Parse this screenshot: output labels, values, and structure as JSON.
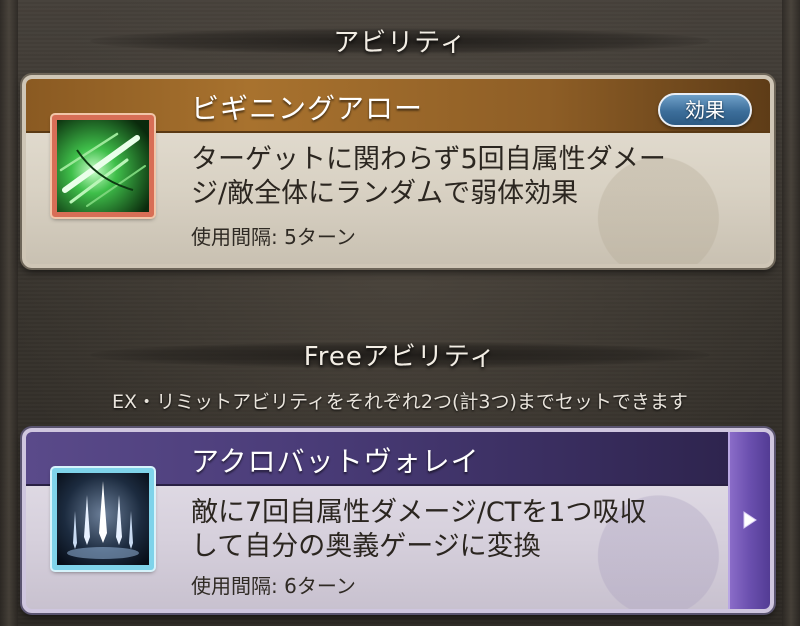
{
  "sections": {
    "ability": {
      "header": "アビリティ"
    },
    "free": {
      "header": "Freeアビリティ",
      "note": "EX・リミットアビリティをそれぞれ2つ(計3つ)までセットできます"
    }
  },
  "ability_card": {
    "name": "ビギニングアロー",
    "effect_button": "効果",
    "description_line1": "ターゲットに関わらず5回自属性ダメー",
    "description_line2": "ジ/敵全体にランダムで弱体効果",
    "cooldown": "使用間隔: 5ターン",
    "icon": "green-arrow-burst-icon"
  },
  "free_card": {
    "name": "アクロバットヴォレイ",
    "description_line1": "敵に7回自属性ダメージ/CTを1つ吸収",
    "description_line2": "して自分の奥義ゲージに変換",
    "cooldown": "使用間隔: 6ターン",
    "icon": "white-arrow-volley-icon",
    "scroll_icon": "triangle-right-icon"
  },
  "colors": {
    "gold_titlebar": "#a8722e",
    "purple_titlebar": "#4a3c78",
    "effect_button": "#3c6e9a",
    "scroll_tab": "#6a4fae"
  }
}
